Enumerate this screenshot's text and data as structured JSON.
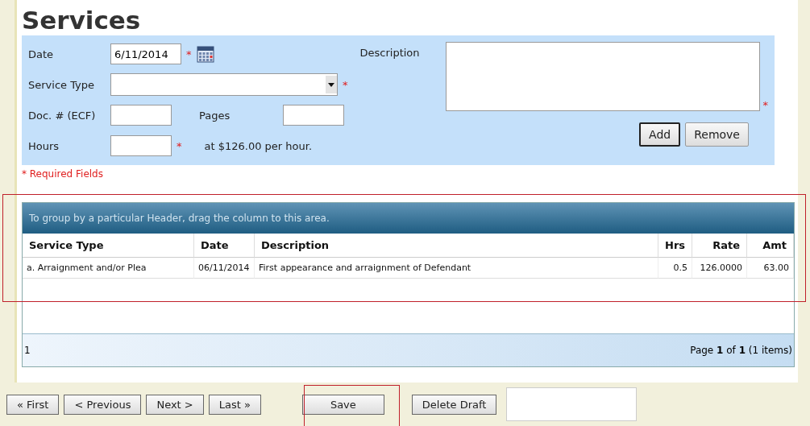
{
  "title": "Services",
  "form": {
    "date": {
      "label": "Date",
      "value": "6/11/2014",
      "required_mark": "*"
    },
    "service_type": {
      "label": "Service Type",
      "required_mark": "*"
    },
    "doc_number": {
      "label": "Doc. # (ECF)"
    },
    "pages": {
      "label": "Pages"
    },
    "hours": {
      "label": "Hours",
      "required_mark": "*"
    },
    "rate_note": "at $126.00 per hour.",
    "description": {
      "label": "Description",
      "required_mark": "*"
    },
    "buttons": [
      {
        "label": "Add",
        "default": true
      },
      {
        "label": "Remove",
        "default": false
      }
    ],
    "required_note": "* Required Fields"
  },
  "grid": {
    "group_panel": "To group by a particular Header, drag the column to this area.",
    "columns": [
      "Service Type",
      "Date",
      "Description",
      "Hrs",
      "Rate",
      "Amt"
    ],
    "rows": [
      [
        "a. Arraignment and/or Plea",
        "06/11/2014",
        "First appearance and arraignment of Defendant",
        "0.5",
        "126.0000",
        "63.00"
      ]
    ],
    "footer_count": "1",
    "pager": "Page **1** of **1** (1 items)",
    "highlighted": true
  },
  "nav_buttons": [
    "« First",
    "< Previous",
    "Next >",
    "Last »"
  ],
  "save": {
    "label": "Save",
    "highlighted": true
  },
  "delete_draft": "Delete Draft"
}
